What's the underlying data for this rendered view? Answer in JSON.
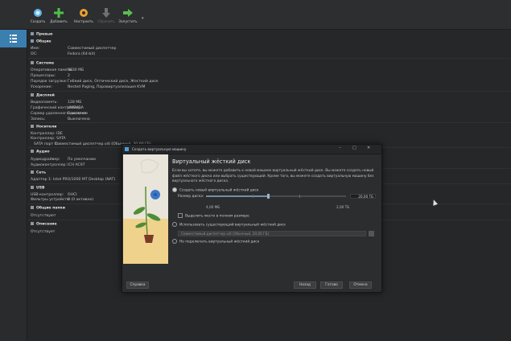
{
  "toolbar": {
    "create_label": "Создать",
    "add_label": "Добавить",
    "settings_label": "Настроить",
    "discard_label": "Сбросить",
    "start_label": "Запустить"
  },
  "details": {
    "preview_title": "Превью",
    "general": {
      "title": "Общие",
      "name_key": "Имя:",
      "name_val": "Совместимый диспетчер",
      "os_key": "ОС:",
      "os_val": "Fedora (64-bit)"
    },
    "system": {
      "title": "Система",
      "memory_key": "Оперативная память:",
      "memory_val": "3830 МБ",
      "cpu_key": "Процессоры:",
      "cpu_val": "2",
      "boot_key": "Порядок загрузки:",
      "boot_val": "Гибкий диск, Оптический диск, Жесткий диск",
      "accel_key": "Ускорение:",
      "accel_val": "Nested Paging, Паравиртуализация KVM"
    },
    "display": {
      "title": "Дисплей",
      "vram_key": "Видеопамять:",
      "vram_val": "128 МБ",
      "gc_key": "Графический контроллер:",
      "gc_val": "VMSVGA",
      "rds_key": "Сервер удаленного дисплея:",
      "rds_val": "Выключен",
      "rec_key": "Запись:",
      "rec_val": "Выключена"
    },
    "storage": {
      "title": "Носители",
      "ctrl_ide": "Контроллер: IDE",
      "ctrl_sata": "Контроллер: SATA",
      "sata_port": "SATA порт 0:",
      "sata_val": "Совместимый диспетчер.vdi (Обычный, 20,00 ГБ)"
    },
    "audio": {
      "title": "Аудио",
      "driver_key": "Аудиодрайвер:",
      "driver_val": "По умолчанию",
      "ctrl_key": "Аудиоконтроллер:",
      "ctrl_val": "ICH AC97"
    },
    "network": {
      "title": "Сеть",
      "adapter_key": "Адаптер 1:",
      "adapter_val": "Intel PRO/1000 MT Desktop (NAT)"
    },
    "usb": {
      "title": "USB",
      "ctrl_key": "USB-контроллер:",
      "ctrl_val": "OHCI",
      "filter_key": "Фильтры устройств:",
      "filter_val": "0 (0 активно)"
    },
    "shared": {
      "title": "Общие папки",
      "val": "Отсутствуют"
    },
    "description": {
      "title": "Описание",
      "val": "Отсутствует"
    }
  },
  "dialog": {
    "window_title": "Создать виртуальную машину",
    "heading": "Виртуальный жёсткий диск",
    "description": "Если вы хотите, вы можете добавить к новой машине виртуальный жёсткий диск. Вы можете создать новый файл жёсткого диска или выбрать существующий. Кроме того, вы можете создать виртуальную машину без виртуального жёсткого диска.",
    "opt_create": "Создать новый виртуальный жёсткий диск",
    "disk_size_label": "Размер диска:",
    "disk_size_value": "20,00 ГБ",
    "size_min": "4,00 МБ",
    "size_max": "2,00 ТБ",
    "prealloc_label": "Выделить место в полном размере",
    "opt_existing": "Использовать существующий виртуальный жёсткий диск",
    "existing_placeholder": "Совместимый диспетчер.vdi (Обычный, 20,00 ГБ)",
    "opt_none": "Не подключать виртуальный жёсткий диск",
    "help_btn": "Справка",
    "back_btn": "Назад",
    "finish_btn": "Готово",
    "cancel_btn": "Отмена"
  }
}
